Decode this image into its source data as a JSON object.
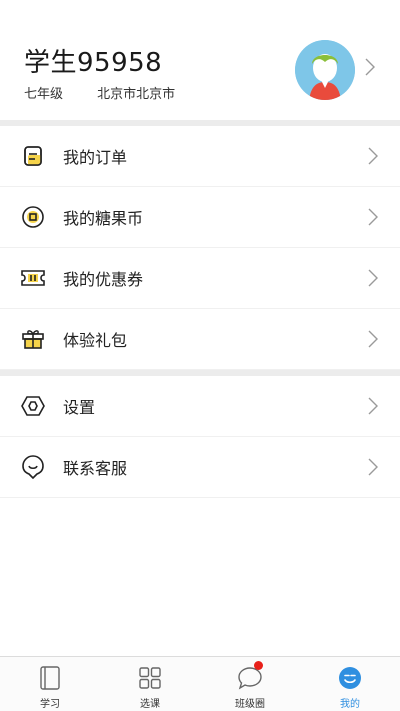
{
  "profile": {
    "name": "学生95958",
    "grade": "七年级",
    "location": "北京市北京市"
  },
  "menu_group_1": [
    {
      "label": "我的订单",
      "icon": "order-icon"
    },
    {
      "label": "我的糖果币",
      "icon": "coin-icon"
    },
    {
      "label": "我的优惠券",
      "icon": "coupon-icon"
    },
    {
      "label": "体验礼包",
      "icon": "gift-icon"
    }
  ],
  "menu_group_2": [
    {
      "label": "设置",
      "icon": "settings-icon"
    },
    {
      "label": "联系客服",
      "icon": "customer-service-icon"
    }
  ],
  "tabbar": {
    "tabs": [
      {
        "label": "学习",
        "icon": "book-icon"
      },
      {
        "label": "选课",
        "icon": "grid-icon"
      },
      {
        "label": "班级圈",
        "icon": "chat-bubble-icon",
        "badge": true
      },
      {
        "label": "我的",
        "icon": "smiley-icon",
        "active": true
      }
    ]
  },
  "colors": {
    "accent": "#2f8fe0",
    "badge": "#e8201a",
    "icon_yellow": "#f5d34a",
    "avatar_bg": "#7ec6e8"
  }
}
